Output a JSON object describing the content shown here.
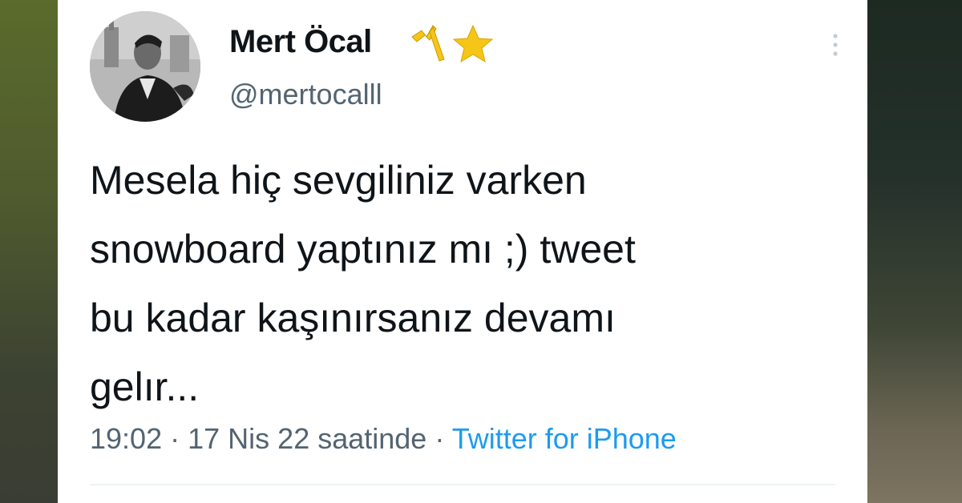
{
  "tweet": {
    "author_name": "Mert Öcal",
    "author_handle": "@mertocalll",
    "author_badges": [
      "bolt-emoji-icon",
      "star-emoji-icon"
    ],
    "text": "Mesela hiç sevgiliniz varken\nsnowboard yaptınız mı ;) tweet\nbu kadar kaşınırsanız devamı\ngelır...",
    "time": "19:02",
    "separator": "·",
    "date": "17 Nis 22 saatinde",
    "source": "Twitter for iPhone"
  },
  "colors": {
    "background": "#ffffff",
    "text_primary": "#0f1419",
    "text_secondary": "#536471",
    "link": "#1d9bf0",
    "star": "#f5c518"
  }
}
